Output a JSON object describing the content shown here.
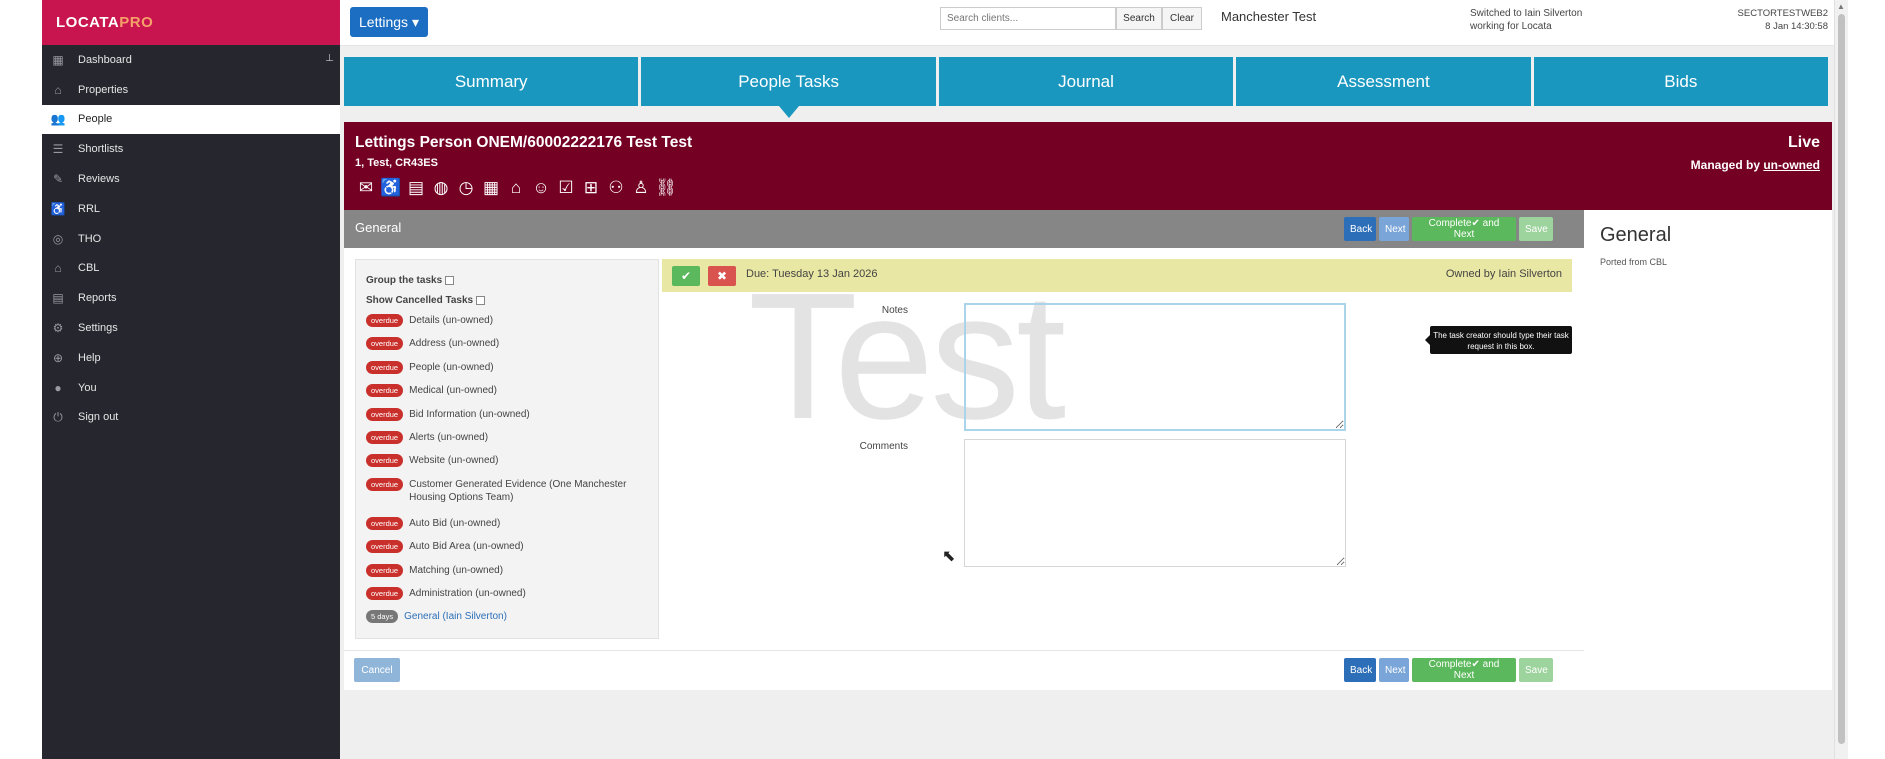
{
  "sidebar": {
    "logo_main": "LOCATA",
    "logo_pro": "PRO",
    "pin_icon": "pin-icon",
    "items": [
      {
        "label": "Dashboard",
        "icon": "grid-icon"
      },
      {
        "label": "Properties",
        "icon": "home-icon"
      },
      {
        "label": "People",
        "icon": "people-icon"
      },
      {
        "label": "Shortlists",
        "icon": "list-icon"
      },
      {
        "label": "Reviews",
        "icon": "pencil-icon"
      },
      {
        "label": "RRL",
        "icon": "person-cane-icon"
      },
      {
        "label": "THO",
        "icon": "target-icon"
      },
      {
        "label": "CBL",
        "icon": "house-icon"
      },
      {
        "label": "Reports",
        "icon": "document-icon"
      },
      {
        "label": "Settings",
        "icon": "gear-icon"
      },
      {
        "label": "Help",
        "icon": "lifebuoy-icon"
      },
      {
        "label": "You",
        "icon": "user-icon"
      },
      {
        "label": "Sign out",
        "icon": "power-icon"
      }
    ],
    "active_index": 2
  },
  "topbar": {
    "lettings_label": "Lettings ▾",
    "search_placeholder": "Search clients...",
    "search_label": "Search",
    "clear_label": "Clear",
    "org_name": "Manchester Test",
    "switched_line1": "Switched to Iain Silverton",
    "switched_line2": "working for Locata",
    "server_line1": "SECTORTESTWEB2",
    "server_line2": "8 Jan 14:30:58"
  },
  "tabs": [
    "Summary",
    "People Tasks",
    "Journal",
    "Assessment",
    "Bids"
  ],
  "active_tab": 1,
  "person": {
    "title": "Lettings Person ONEM/60002222176 Test Test",
    "address": "1, Test, CR43ES",
    "status": "Live",
    "managed_prefix": "Managed by ",
    "managed_by": "un-owned",
    "icons": [
      "envelope-icon",
      "person-wheelchair-icon",
      "document-list-icon",
      "globe-icon",
      "clock-icon",
      "calendar-icon",
      "person-house-icon",
      "smile-icon",
      "clipboard-check-icon",
      "clipboard-plus-icon",
      "people-walk-icon",
      "person-walk-icon",
      "link-icon"
    ]
  },
  "general_bar": {
    "title": "General",
    "back": "Back",
    "next": "Next",
    "complete": "Complete✔ and Next",
    "save": "Save"
  },
  "tasklist": {
    "group_label": "Group the tasks",
    "show_cancelled_label": "Show Cancelled Tasks",
    "tasks": [
      {
        "badge": "overdue",
        "label": "Details (un-owned)"
      },
      {
        "badge": "overdue",
        "label": "Address (un-owned)"
      },
      {
        "badge": "overdue",
        "label": "People (un-owned)"
      },
      {
        "badge": "overdue",
        "label": "Medical (un-owned)"
      },
      {
        "badge": "overdue",
        "label": "Bid Information (un-owned)"
      },
      {
        "badge": "overdue",
        "label": "Alerts (un-owned)"
      },
      {
        "badge": "overdue",
        "label": "Website (un-owned)"
      },
      {
        "badge": "overdue",
        "label": "Customer Generated Evidence (One Manchester Housing Options Team)"
      },
      {
        "badge": "overdue",
        "label": "Auto Bid (un-owned)"
      },
      {
        "badge": "overdue",
        "label": "Auto Bid Area (un-owned)"
      },
      {
        "badge": "overdue",
        "label": "Matching (un-owned)"
      },
      {
        "badge": "overdue",
        "label": "Administration (un-owned)"
      },
      {
        "badge": "5 days",
        "label": "General (Iain Silverton)"
      }
    ]
  },
  "task": {
    "due": "Due: Tuesday 13 Jan 2026",
    "owned_by": "Owned by Iain Silverton",
    "watermark": "Test",
    "notes_label": "Notes",
    "comments_label": "Comments",
    "tooltip": "The task creator should type their task request in this box."
  },
  "footer": {
    "cancel": "Cancel",
    "back": "Back",
    "next": "Next",
    "complete": "Complete✔ and Next",
    "save": "Save"
  },
  "side_panel": {
    "title": "General",
    "subtitle": "Ported from CBL"
  }
}
